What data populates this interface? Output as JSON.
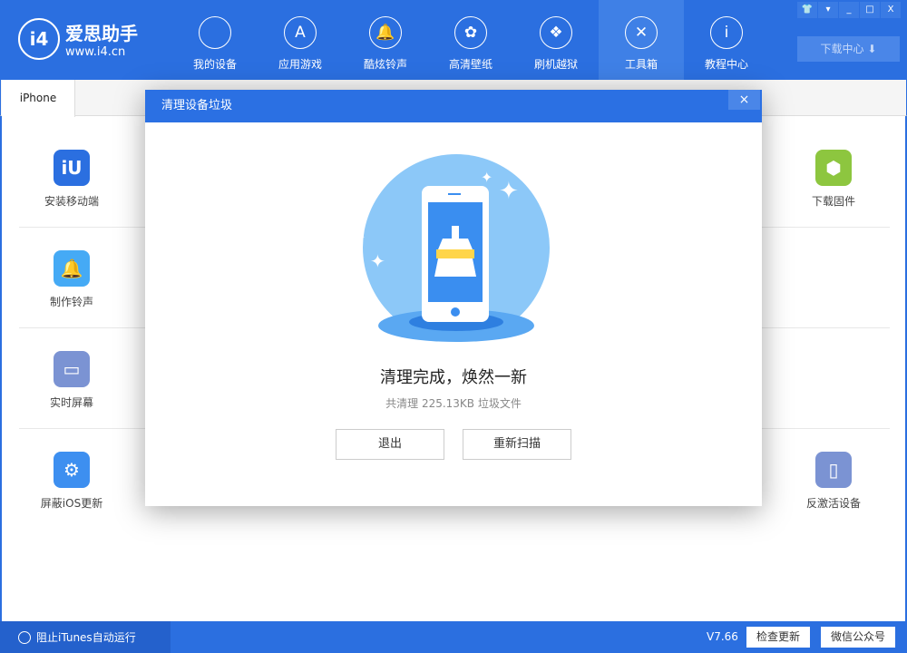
{
  "app": {
    "logo_title": "爱思助手",
    "logo_url": "www.i4.cn",
    "logo_mark": "i4"
  },
  "nav": [
    {
      "label": "我的设备",
      "icon": "apple-icon",
      "glyph": ""
    },
    {
      "label": "应用游戏",
      "icon": "app-store-icon",
      "glyph": "A"
    },
    {
      "label": "酷炫铃声",
      "icon": "bell-icon",
      "glyph": "🔔"
    },
    {
      "label": "高清壁纸",
      "icon": "flower-icon",
      "glyph": "✿"
    },
    {
      "label": "刷机越狱",
      "icon": "dropbox-icon",
      "glyph": "❖"
    },
    {
      "label": "工具箱",
      "icon": "tools-icon",
      "glyph": "✕"
    },
    {
      "label": "教程中心",
      "icon": "info-icon",
      "glyph": "i"
    }
  ],
  "active_nav": "工具箱",
  "window_controls": [
    "skin",
    "menu",
    "minimize",
    "maximize",
    "close"
  ],
  "download_center": "下载中心",
  "tab": "iPhone",
  "tools_left": [
    {
      "label": "安装移动端",
      "icon": "i4-app-icon",
      "color": "#2b6fe0",
      "glyph": "iU"
    },
    {
      "label": "制作铃声",
      "icon": "bell-plus-icon",
      "color": "#45aaf5",
      "glyph": "🔔"
    },
    {
      "label": "实时屏幕",
      "icon": "monitor-icon",
      "color": "#7b93d3",
      "glyph": "▭"
    },
    {
      "label": "屏蔽iOS更新",
      "icon": "gear-block-icon",
      "color": "#3d8ff0",
      "glyph": "⚙"
    }
  ],
  "tools_right": [
    {
      "label": "下载固件",
      "icon": "cube-icon",
      "color": "#8dc63f",
      "glyph": "⬢"
    },
    {
      "label": "反激活设备",
      "icon": "tablet-icon",
      "color": "#7b93d3",
      "glyph": "▯"
    }
  ],
  "modal": {
    "title": "清理设备垃圾",
    "close": "×",
    "result_title": "清理完成，焕然一新",
    "result_sub": "共清理 225.13KB 垃圾文件",
    "exit": "退出",
    "rescan": "重新扫描"
  },
  "footer": {
    "itunes": "阻止iTunes自动运行",
    "version": "V7.66",
    "check_update": "检查更新",
    "wechat": "微信公众号"
  },
  "colors": {
    "brand": "#2b6fe0",
    "illustration": "#8cc8f8"
  }
}
